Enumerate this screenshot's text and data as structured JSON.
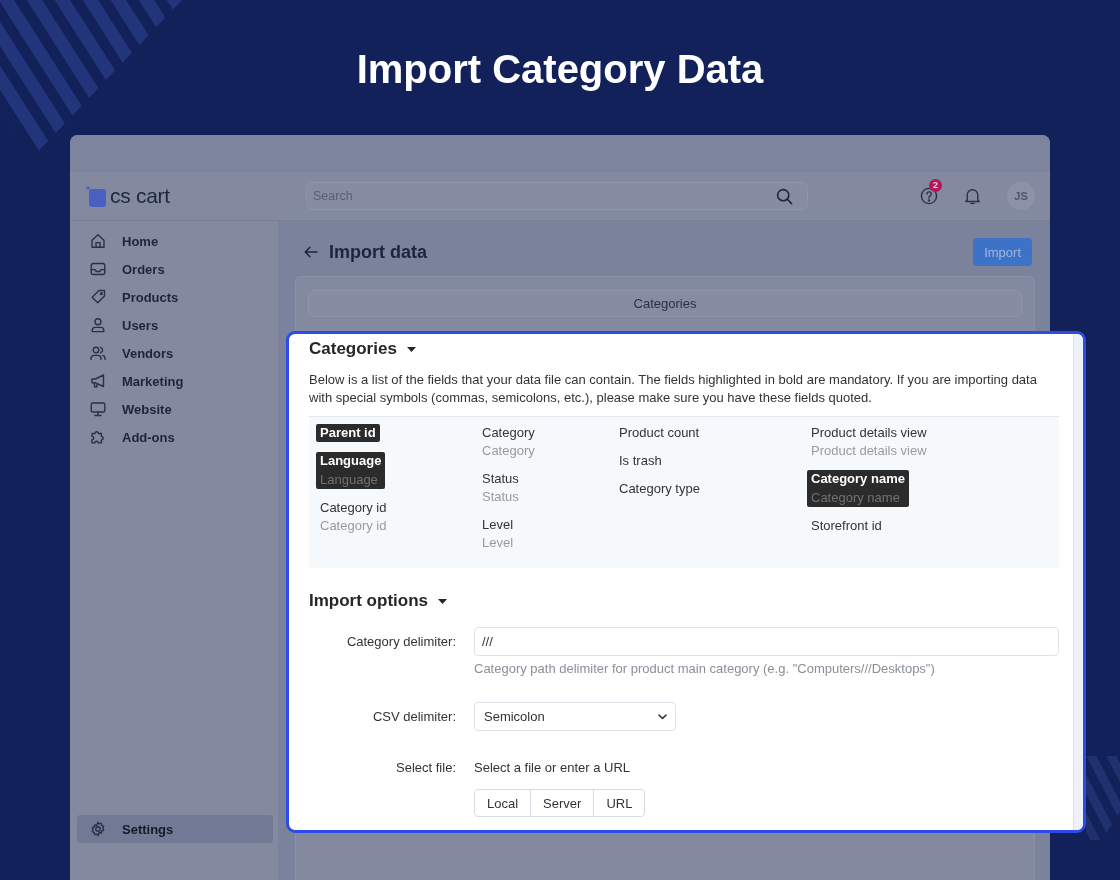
{
  "banner": {
    "title": "Import Category Data"
  },
  "header": {
    "logo": "cs cart",
    "search": {
      "placeholder": "Search"
    },
    "help_badge": "2",
    "avatar": "JS"
  },
  "sidebar": {
    "items": [
      {
        "label": "Home",
        "selected": false
      },
      {
        "label": "Orders",
        "selected": false
      },
      {
        "label": "Products",
        "selected": false
      },
      {
        "label": "Users",
        "selected": false
      },
      {
        "label": "Vendors",
        "selected": false
      },
      {
        "label": "Marketing",
        "selected": false
      },
      {
        "label": "Website",
        "selected": false
      },
      {
        "label": "Add-ons",
        "selected": false
      }
    ],
    "bottom_items": [
      {
        "label": "Settings",
        "selected": true
      }
    ]
  },
  "page": {
    "title": "Import data",
    "primary_button": "Import",
    "object_tab": "Categories"
  },
  "fields_section": {
    "title": "Categories",
    "description": "Below is a list of the fields that your data file can contain. The fields highlighted in bold are mandatory. If you are importing data with special symbols (commas, semicolons, etc.), please make sure you have these fields quoted.",
    "columns": [
      {
        "fields": [
          {
            "name": "Parent id",
            "mandatory": true
          },
          {
            "name": "Language",
            "example": "Language",
            "mandatory": true
          },
          {
            "name": "Category id",
            "example": "Category id",
            "mandatory": false
          }
        ]
      },
      {
        "fields": [
          {
            "name": "Category",
            "example": "Category",
            "mandatory": false
          },
          {
            "name": "Status",
            "example": "Status",
            "mandatory": false
          },
          {
            "name": "Level",
            "example": "Level",
            "mandatory": false
          }
        ]
      },
      {
        "fields": [
          {
            "name": "Product count",
            "mandatory": false
          },
          {
            "name": "Is trash",
            "mandatory": false
          },
          {
            "name": "Category type",
            "mandatory": false
          }
        ]
      },
      {
        "fields": [
          {
            "name": "Product details view",
            "example": "Product details view",
            "mandatory": false
          },
          {
            "name": "Category name",
            "example": "Category name",
            "mandatory": true
          },
          {
            "name": "Storefront id",
            "mandatory": false
          }
        ]
      }
    ]
  },
  "import_options": {
    "title": "Import options",
    "rows": [
      {
        "kind": "text",
        "label": "Category delimiter:",
        "value": "///",
        "help": "Category path delimiter for product main category (e.g. \"Computers///Desktops\")"
      },
      {
        "kind": "select",
        "label": "CSV delimiter:",
        "value": "Semicolon"
      },
      {
        "kind": "file",
        "label": "Select file:",
        "text": "Select a file or enter a URL",
        "buttons": [
          "Local",
          "Server",
          "URL"
        ]
      }
    ]
  }
}
